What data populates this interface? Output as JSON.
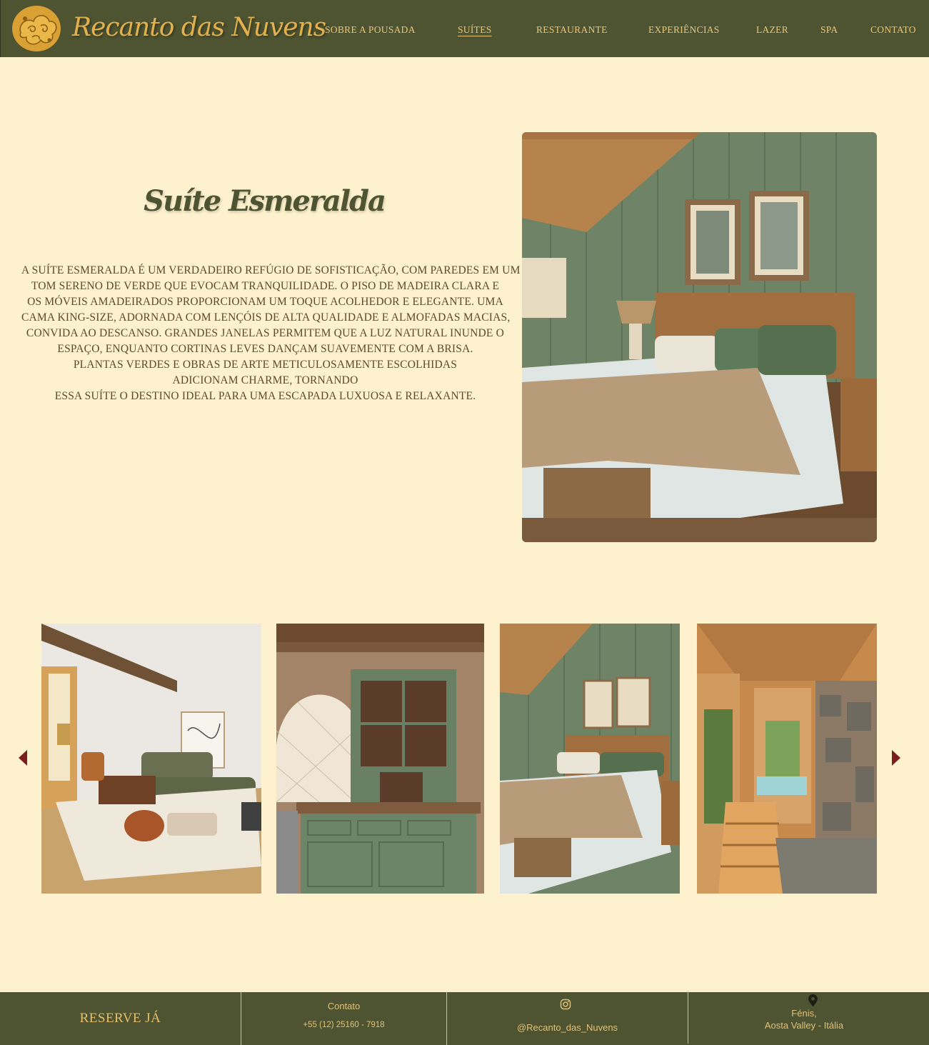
{
  "header": {
    "brand": "Recanto das Nuvens",
    "logo_icon": "cloud-swirl-logo-icon",
    "nav": [
      {
        "label": "Sobre a Pousada",
        "active": false
      },
      {
        "label": "Suítes",
        "active": true
      },
      {
        "label": "Restaurante",
        "active": false
      },
      {
        "label": "Experiências",
        "active": false
      },
      {
        "label": "Lazer",
        "active": false
      },
      {
        "label": "Spa",
        "active": false
      },
      {
        "label": "Contato",
        "active": false
      }
    ]
  },
  "hero": {
    "title": "Suíte Esmeralda",
    "description_lines": [
      "A Suíte Esmeralda é um verdadeiro refúgio de sofisticação, com paredes em um",
      "tom sereno de verde que evocam tranquilidade. O piso de madeira clara e",
      "os móveis amadeirados proporcionam um toque acolhedor e elegante. Uma",
      "cama king-size, adornada com lençóis de alta qualidade e almofadas macias,",
      "convida ao descanso. Grandes janelas permitem que a luz natural inunde o",
      "espaço, enquanto cortinas leves dançam suavemente com a brisa.",
      "Plantas verdes e obras de arte meticulosamente escolhidas",
      "adicionam charme, tornando",
      "essa suíte o destino ideal para uma escapada luxuosa e relaxante."
    ]
  },
  "carousel": {
    "prev_icon": "caret-left-icon",
    "next_icon": "caret-right-icon",
    "images": [
      "living-room-photo",
      "green-cabinet-kitchen-photo",
      "green-bedroom-photo",
      "wooden-bathroom-photo"
    ]
  },
  "footer": {
    "reserve_label": "Reserve já",
    "contact_title": "Contato",
    "phone": "+55 (12) 25160 - 7918",
    "instagram_icon": "instagram-icon",
    "instagram_handle": "@Recanto_das_Nuvens",
    "location_icon": "map-pin-icon",
    "location_line1": "Fénis,",
    "location_line2": "Aosta Valley -  Itália"
  },
  "colors": {
    "header_bg": "#4e5431",
    "page_bg": "#fef1cd",
    "gold": "#e3b04e",
    "arrow": "#7a1e1e"
  }
}
